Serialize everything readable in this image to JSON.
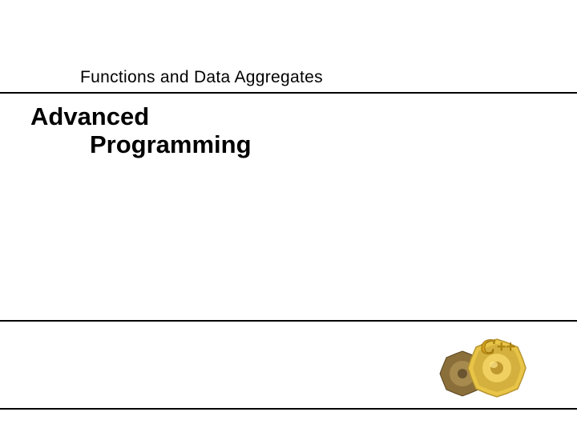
{
  "header": {
    "chapter_title": "Functions and Data Aggregates"
  },
  "title": {
    "line1": "Advanced",
    "line2": "Programming"
  },
  "logo": {
    "label_c": "C",
    "label_plus": "++",
    "semantic": "cpp-gear-logo"
  }
}
